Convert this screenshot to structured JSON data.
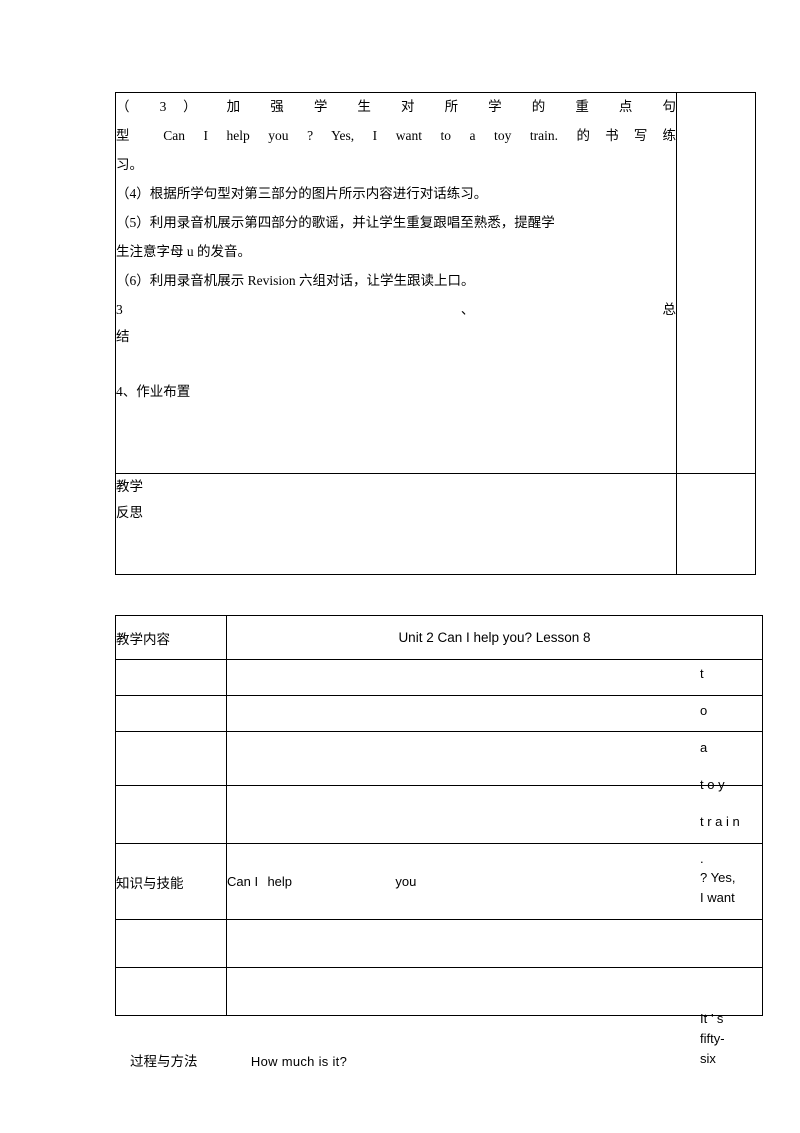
{
  "doc": {
    "table1": {
      "items": [
        "（ 3 ） 加 强 学 生 对 所 学 的 重 点 句",
        "型 Can I help you ? Yes, I want to a toy train. 的书写练",
        "习。",
        "（4）根据所学句型对第三部分的图片所示内容进行对话练习。",
        "（5）利用录音机展示第四部分的歌谣，并让学生重复跟唱至熟悉，提醒学",
        "生注意字母 u 的发音。",
        "（6）利用录音机展示 Revision 六组对话，让学生跟读上口。"
      ],
      "summary_num": "3",
      "summary_mark": "、",
      "summary_word_1": "总",
      "summary_word_2": "结",
      "homework": "4、作业布置",
      "reflection_label_1": "教学",
      "reflection_label_2": "反思"
    },
    "table2": {
      "row_title_label": "教学内容",
      "row_title_value": "Unit 2 Can I help you? Lesson 8",
      "row_knowledge_label": "知识与技能",
      "row_knowledge_en_1": "Can I",
      "row_knowledge_en_2": "help",
      "row_knowledge_en_3": "you"
    },
    "margin": {
      "vertical_fragments": [
        "t",
        "o",
        "a",
        "t o y",
        "t r a i n",
        "."
      ],
      "block2": [
        "? Yes,",
        "I want"
      ],
      "block3": [
        "It ’ s",
        "fifty-",
        "six"
      ]
    },
    "bottom": {
      "label": "过程与方法",
      "question": "How  much  is    it?"
    }
  }
}
